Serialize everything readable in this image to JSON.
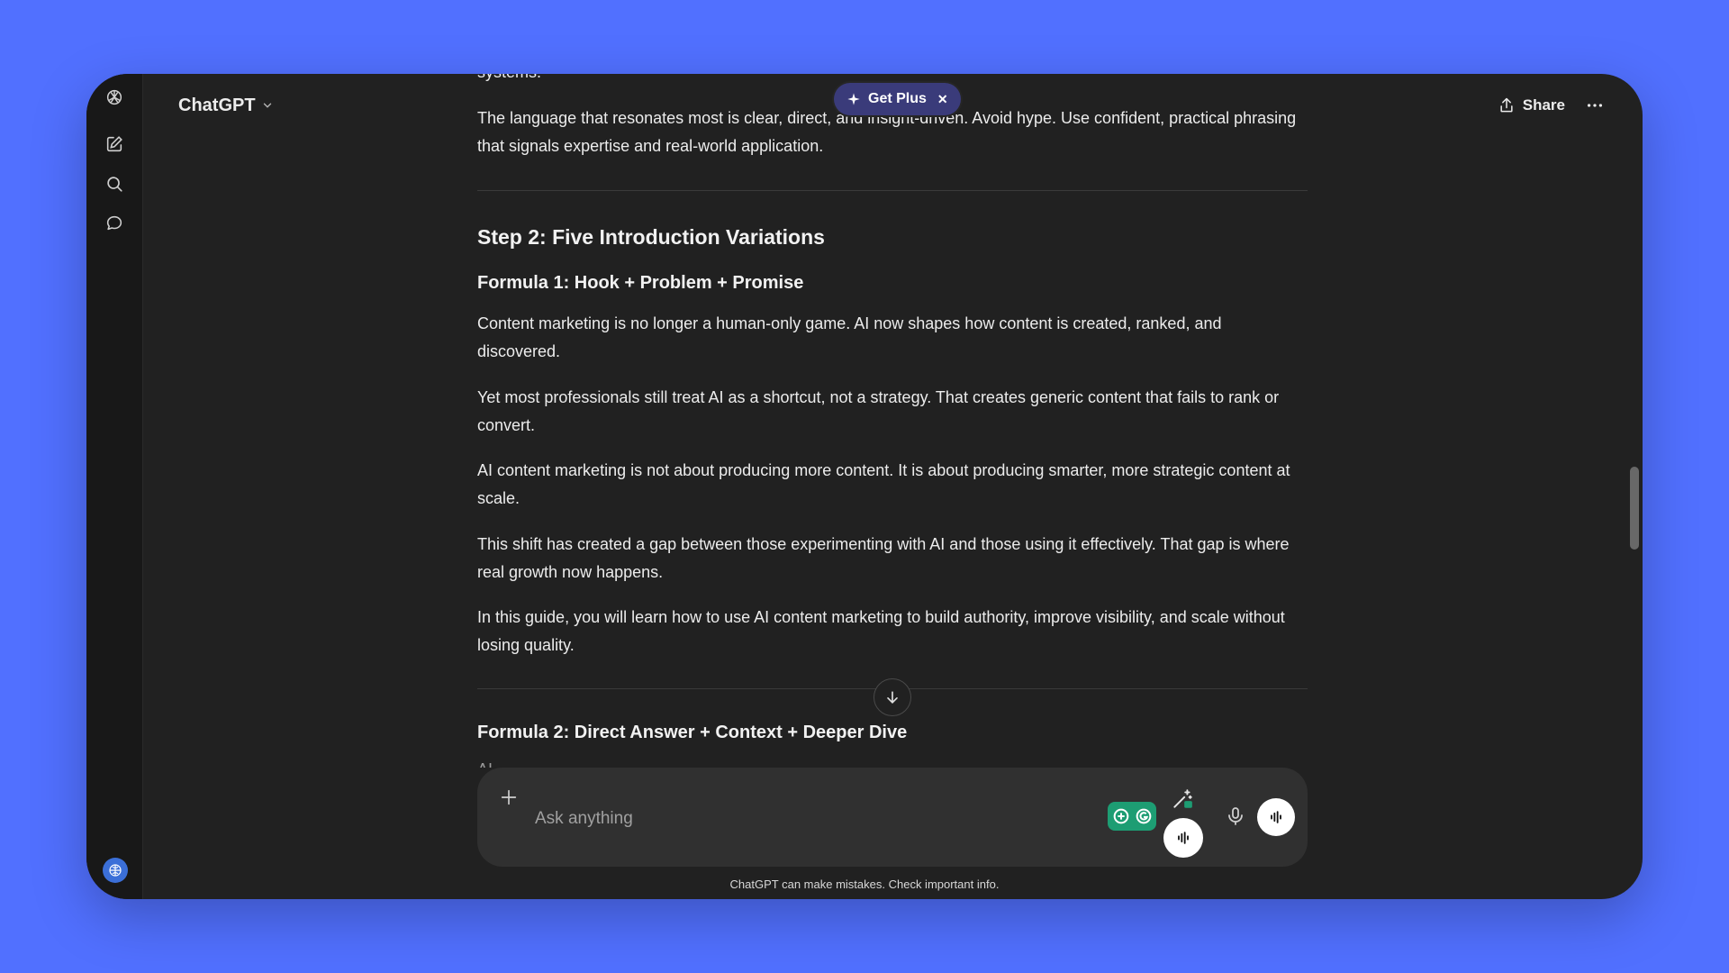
{
  "app": {
    "model_label": "ChatGPT",
    "get_plus_label": "Get Plus",
    "share_label": "Share"
  },
  "conversation": {
    "cutoff_text": "systems.",
    "language_para": "The language that resonates most is clear, direct, and insight-driven. Avoid hype. Use confident, practical phrasing that signals expertise and real-world application.",
    "step2_heading": "Step 2: Five Introduction Variations",
    "formula1_heading": "Formula 1: Hook + Problem + Promise",
    "paragraphs": [
      "Content marketing is no longer a human-only game. AI now shapes how content is created, ranked, and discovered.",
      "Yet most professionals still treat AI as a shortcut, not a strategy. That creates generic content that fails to rank or convert.",
      "AI content marketing is not about producing more content. It is about producing smarter, more strategic content at scale.",
      "This shift has created a gap between those experimenting with AI and those using it effectively. That gap is where real growth now happens.",
      "In this guide, you will learn how to use AI content marketing to build authority, improve visibility, and scale without losing quality."
    ],
    "formula2_heading": "Formula 2: Direct Answer + Context + Deeper Dive",
    "ghost_text": "AI"
  },
  "composer": {
    "placeholder": "Ask anything"
  },
  "footer": {
    "disclaimer": "ChatGPT can make mistakes. Check important info."
  },
  "colors": {
    "background": "#5170ff",
    "window": "#212121",
    "composer": "#303030",
    "get_plus": "#3a3b7a"
  }
}
